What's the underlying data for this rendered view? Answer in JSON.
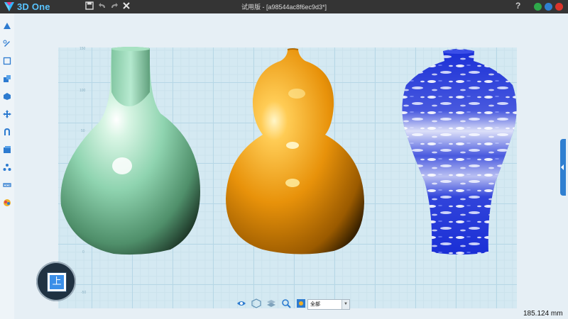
{
  "app": {
    "name": "3D One",
    "window_title": "试用版 - [a98544ac8f6ec9d3*]"
  },
  "toolbar": {
    "save_icon": "save-icon",
    "undo_icon": "undo-icon",
    "redo_icon": "redo-icon",
    "tools_icon": "tools-icon"
  },
  "window_controls": {
    "help_label": "?"
  },
  "viewcube": {
    "face_label": "上"
  },
  "filter": {
    "value": "全部"
  },
  "status": {
    "measurement": "185.124 mm"
  },
  "grid_labels": [
    "150",
    "100",
    "50",
    "0",
    "-50"
  ],
  "colors": {
    "title_bar": "#343434",
    "celadon": "#8fd4b0",
    "gold": "#e8920a",
    "cobalt": "#1a2fd6",
    "accent": "#2f7fd1"
  }
}
